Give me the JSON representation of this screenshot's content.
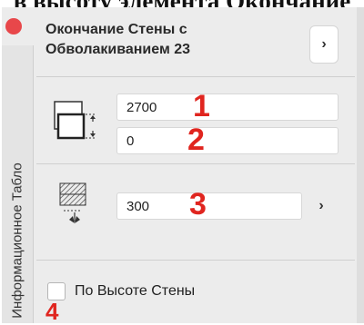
{
  "caption": "в высоту элемента Окончание",
  "panel": {
    "title": "Окончание Стены с Обволакиванием 23",
    "side_tab_label": "Информационное Табло",
    "nav_glyph": "›",
    "colors": {
      "close": "#e8474a",
      "marker": "#e0251f",
      "panel": "#ececec"
    }
  },
  "height_section": {
    "icon": "wall-end-height-icon",
    "fields": [
      {
        "value": "2700",
        "marker": "1"
      },
      {
        "value": "0",
        "marker": "2"
      }
    ]
  },
  "depth_section": {
    "icon": "wall-wrap-depth-icon",
    "field": {
      "value": "300",
      "marker": "3"
    },
    "button_glyph": "›"
  },
  "option": {
    "label": "По Высоте Стены",
    "checked": false,
    "marker": "4"
  }
}
